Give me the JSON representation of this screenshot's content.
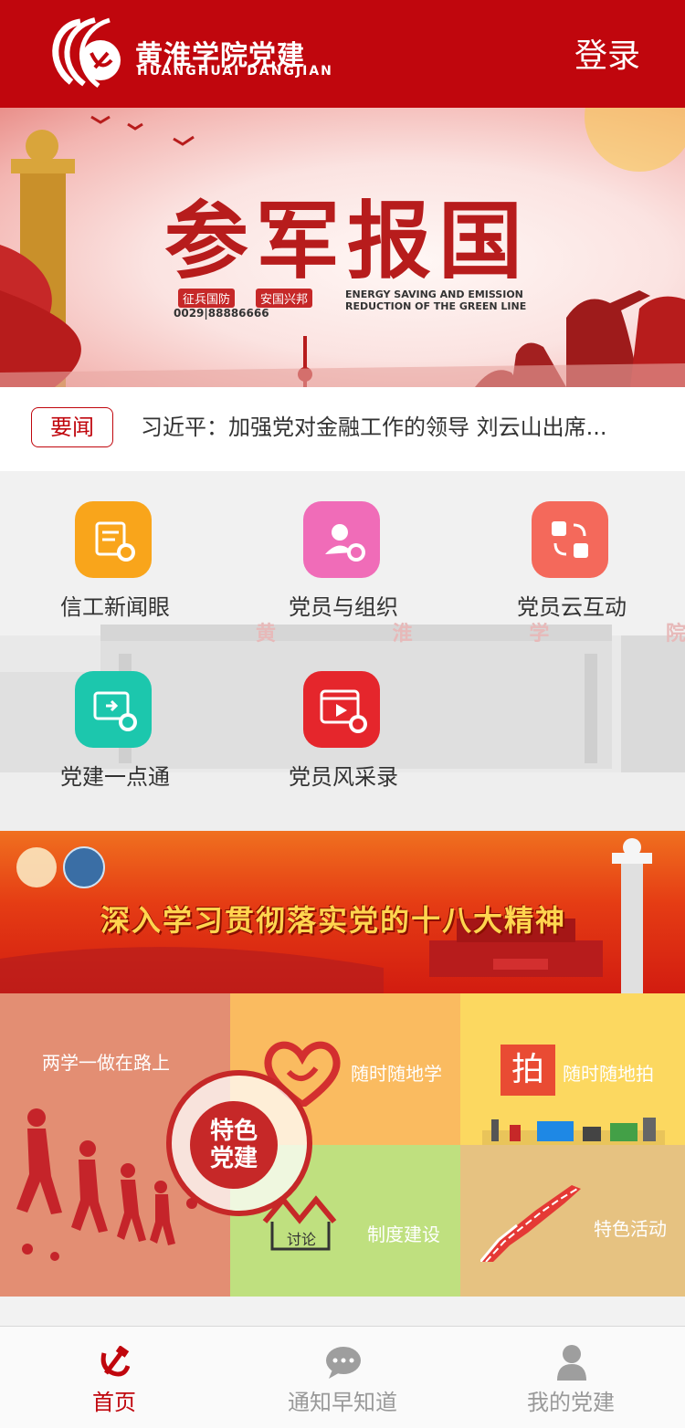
{
  "header": {
    "logo_title": "黄淮学院党建",
    "logo_subtitle": "HUANGHUAI   DANGJIAN",
    "login_label": "登录",
    "color": "#c0060d"
  },
  "banner": {
    "title": "参军报国",
    "tag1": "征兵国防",
    "tag2": "安国兴邦",
    "english": "ENERGY SAVING AND EMISSION REDUCTION OF THE GREEN LINE",
    "phone": "0029|88886666"
  },
  "ticker": {
    "badge": "要闻",
    "text": "习近平：加强党对金融工作的领导 刘云山出席..."
  },
  "menu": [
    {
      "label": "信工新闻眼",
      "color": "#f9a51b",
      "icon": "news-icon"
    },
    {
      "label": "党员与组织",
      "color": "#f06cb8",
      "icon": "member-icon"
    },
    {
      "label": "党员云互动",
      "color": "#f4695b",
      "icon": "exchange-icon"
    },
    {
      "label": "党建一点通",
      "color": "#1cc7ad",
      "icon": "screen-icon"
    },
    {
      "label": "党员风采录",
      "color": "#e5262c",
      "icon": "video-icon"
    }
  ],
  "grid_bg_text": "黄 淮 学 院 科 技",
  "banner2": {
    "text": "深入学习贯彻落实党的十八大精神"
  },
  "features": {
    "big": {
      "label": "两学一做在路上",
      "stamp": "特色党建",
      "color": "#e38e73"
    },
    "study": {
      "label": "随时随地学",
      "color": "#fabb60"
    },
    "photo": {
      "label": "随时随地拍",
      "badge": "拍",
      "color": "#fcd860"
    },
    "system": {
      "label": "制度建设",
      "sign": "讨论",
      "color": "#bfe07f"
    },
    "activity": {
      "label": "特色活动",
      "color": "#e6c281"
    }
  },
  "bottom_nav": [
    {
      "label": "首页",
      "icon": "hammer-sickle-icon",
      "active": true
    },
    {
      "label": "通知早知道",
      "icon": "chat-icon",
      "active": false
    },
    {
      "label": "我的党建",
      "icon": "user-icon",
      "active": false
    }
  ]
}
